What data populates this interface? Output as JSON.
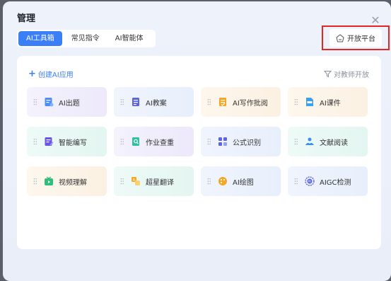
{
  "title": "管理",
  "tabs": [
    {
      "label": "AI工具箱",
      "active": true
    },
    {
      "label": "常见指令",
      "active": false
    },
    {
      "label": "AI智能体",
      "active": false
    }
  ],
  "open_platform": "开放平台",
  "create_label": "创建AI应用",
  "teacher_open_label": "对教师开放",
  "tools": [
    {
      "label": "AI出题",
      "icon": "ai-question-icon",
      "tint": "purple"
    },
    {
      "label": "AI教案",
      "icon": "lesson-plan-icon",
      "tint": "blue"
    },
    {
      "label": "AI写作批阅",
      "icon": "writing-review-icon",
      "tint": "orange"
    },
    {
      "label": "AI课件",
      "icon": "courseware-icon",
      "tint": "orange"
    },
    {
      "label": "智能编写",
      "icon": "smart-write-icon",
      "tint": "teal"
    },
    {
      "label": "作业查重",
      "icon": "homework-check-icon",
      "tint": "purple"
    },
    {
      "label": "公式识别",
      "icon": "formula-icon",
      "tint": "blue"
    },
    {
      "label": "文献阅读",
      "icon": "literature-icon",
      "tint": "teal"
    },
    {
      "label": "视频理解",
      "icon": "video-icon",
      "tint": "orange"
    },
    {
      "label": "超星翻译",
      "icon": "translate-icon",
      "tint": "teal"
    },
    {
      "label": "AI绘图",
      "icon": "paint-icon",
      "tint": "blue"
    },
    {
      "label": "AIGC检测",
      "icon": "aigc-detect-icon",
      "tint": "blue"
    }
  ],
  "colors": {
    "accent": "#3b7ff6",
    "highlight_border": "#e62525"
  }
}
